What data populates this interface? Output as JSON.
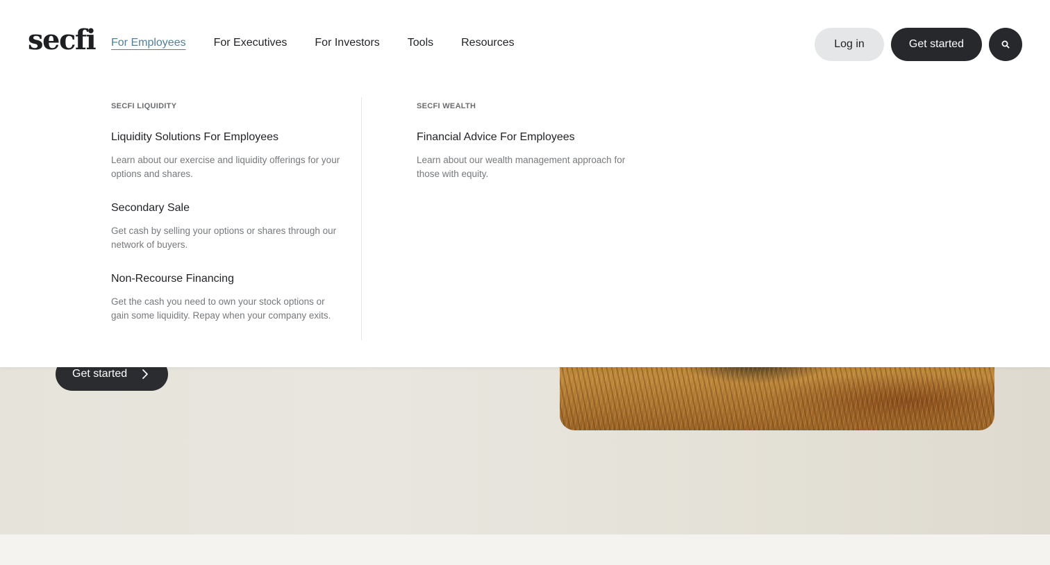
{
  "brand": {
    "logo_text": "secfi"
  },
  "nav": {
    "items": [
      {
        "label": "For Employees",
        "active": true
      },
      {
        "label": "For Executives"
      },
      {
        "label": "For Investors"
      },
      {
        "label": "Tools"
      },
      {
        "label": "Resources"
      }
    ]
  },
  "header_actions": {
    "login_label": "Log in",
    "get_started_label": "Get started",
    "search_icon": "search-icon"
  },
  "mega_menu": {
    "liquidity": {
      "label": "SECFI LIQUIDITY",
      "items": [
        {
          "title": "Liquidity Solutions For Employees",
          "desc": "Learn about our exercise and liquidity offerings for your options and shares."
        },
        {
          "title": "Secondary Sale",
          "desc": "Get cash by selling your options or shares through our network of buyers."
        },
        {
          "title": "Non-Recourse Financing",
          "desc": "Get the cash you need to own your stock options or gain some liquidity. Repay when your company exits."
        }
      ]
    },
    "wealth": {
      "label": "SECFI WEALTH",
      "items": [
        {
          "title": "Financial Advice For Employees",
          "desc": "Learn about our wealth management approach for those with equity."
        }
      ]
    }
  },
  "hero": {
    "cta_label": "Get started",
    "cta_icon": "chevron-right-icon"
  },
  "colors": {
    "accent_link": "#4f7f9a",
    "dark_button": "#26282c",
    "light_button": "#e4e6e7"
  }
}
